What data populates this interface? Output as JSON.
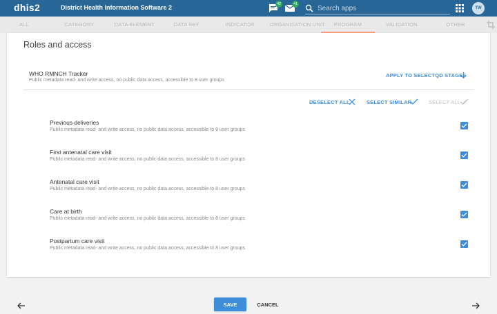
{
  "header": {
    "logo": "dhis2",
    "app_title": "District Health Information Software 2",
    "messages_badge": "42",
    "interpretations_badge": "41",
    "search_placeholder": "Search apps",
    "avatar_initials": "TW",
    "background": "#276696"
  },
  "tabs": [
    {
      "label": "ALL"
    },
    {
      "label": "CATEGORY"
    },
    {
      "label": "DATA ELEMENT"
    },
    {
      "label": "DATA SET"
    },
    {
      "label": "INDICATOR"
    },
    {
      "label": "ORGANISATION UNIT"
    },
    {
      "label": "PROGRAM",
      "active": true
    },
    {
      "label": "VALIDATION"
    },
    {
      "label": "OTHER"
    }
  ],
  "card": {
    "title": "Roles and access",
    "program": {
      "name": "WHO RMNCH Tracker",
      "sharing": "Public metadata read- and write access, no public data access, accessible to 8 user groups"
    },
    "apply_label": "APPLY TO SELECTQD STAGES",
    "actions": {
      "deselect_all": "DESELECT ALL",
      "select_similar": "SELECT SIMILAR",
      "select_all": "SELECT ALL"
    },
    "stages": [
      {
        "name": "Previous deliveries",
        "sharing": "Public metadata read- and write access, no public data access, accessible to 8 user groups",
        "checked": true
      },
      {
        "name": "First antenatal care visit",
        "sharing": "Public metadata read- and write access, no public data access, accessible to 8 user groups",
        "checked": true
      },
      {
        "name": "Antenatal care visit",
        "sharing": "Public metadata read- and write access, no public data access, accessible to 8 user groups",
        "checked": true
      },
      {
        "name": "Care at birth",
        "sharing": "Public metadata read- and write access, no public data access, accessible to 8 user groups",
        "checked": true
      },
      {
        "name": "Postpartum care visit",
        "sharing": "Public metadata read- and write access, no public data access, accessible to 8 user groups",
        "checked": true
      }
    ]
  },
  "footer": {
    "save_label": "SAVE",
    "cancel_label": "CANCEL"
  },
  "colors": {
    "accent": "#3d8ddb",
    "active_tab_underline": "#ff9f80"
  },
  "icons": [
    "chat-icon",
    "mail-icon",
    "search-icon",
    "apps-grid-icon",
    "crop-icon",
    "arrow-down-icon",
    "close-icon",
    "check-icon",
    "double-check-icon",
    "arrow-left-icon",
    "arrow-right-icon"
  ]
}
